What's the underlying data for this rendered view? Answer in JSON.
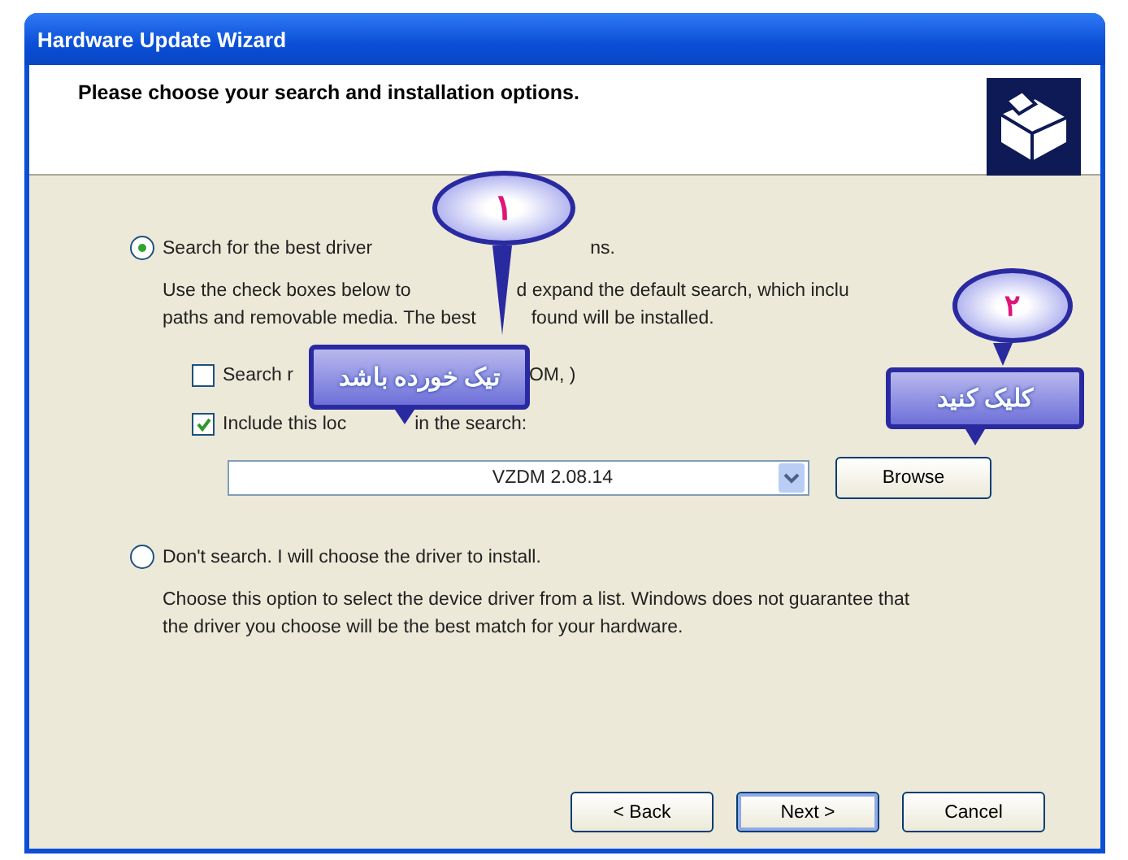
{
  "window": {
    "title": "Hardware Update Wizard"
  },
  "header": {
    "heading": "Please choose your search and installation options."
  },
  "options": [
    {
      "label_parts": [
        "Search for the best driver",
        "ns."
      ],
      "selected": true,
      "description_lines": [
        [
          "Use the check boxes below to",
          "d expand the default search, which inclu"
        ],
        [
          "paths and removable media. The best",
          "found will be installed."
        ]
      ],
      "checkboxes": [
        {
          "label_parts": [
            "Search r",
            "OM, )"
          ],
          "checked": false
        },
        {
          "label_parts": [
            "Include this loc",
            "in the search:"
          ],
          "checked": true
        }
      ],
      "location": {
        "value": "VZDM 2.08.14"
      },
      "browse": "Browse"
    },
    {
      "label_parts": [
        "Don't search. I will choose the driver to install."
      ],
      "selected": false,
      "description_lines": [
        [
          "Choose this option to select the device driver from a list. Windows does not guarantee that"
        ],
        [
          "the driver you choose will be the best match for your hardware."
        ]
      ]
    }
  ],
  "callouts": [
    {
      "number": "١",
      "note": "تیک خورده باشد"
    },
    {
      "number": "۲",
      "note": "کلیک کنید"
    }
  ],
  "buttons": [
    {
      "label": "< Back",
      "selected": false
    },
    {
      "label": "Next >",
      "selected": true
    },
    {
      "label": "Cancel",
      "selected": false
    }
  ]
}
